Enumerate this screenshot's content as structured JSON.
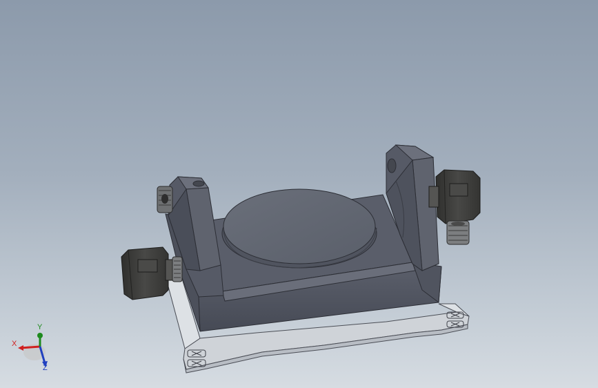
{
  "viewport": {
    "background_top": "#8c9aab",
    "background_bottom": "#d6dce2"
  },
  "model": {
    "body_color": "#565a66",
    "turntable_color": "#60656f",
    "motor_color": "#3e3e3c",
    "pulley_color": "#7c7e80",
    "base_plate_color": "#cfd3d8"
  },
  "triad": {
    "x_label": "X",
    "y_label": "Y",
    "z_label": "Z",
    "x_color": "#d02020",
    "y_color": "#1e8a1e",
    "z_color": "#2040c0"
  }
}
